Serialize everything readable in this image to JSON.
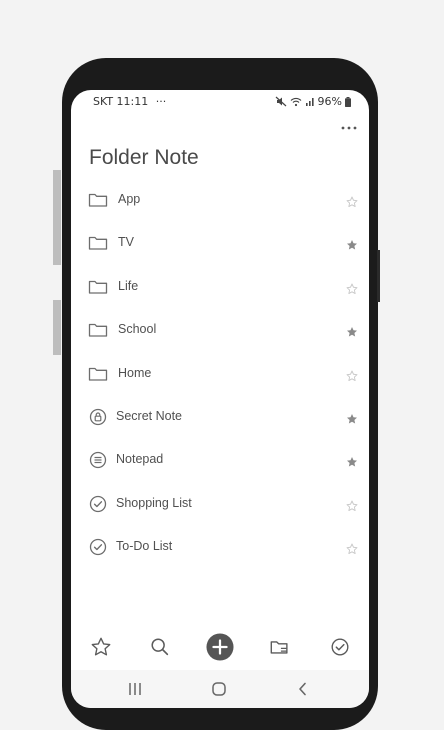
{
  "status_bar": {
    "carrier_time": "SKT 11:11",
    "dots": "···",
    "battery": "96%"
  },
  "page": {
    "title": "Folder Note"
  },
  "items": [
    {
      "label": "App",
      "icon": "folder-icon",
      "starred": false
    },
    {
      "label": "TV",
      "icon": "folder-icon",
      "starred": true
    },
    {
      "label": "Life",
      "icon": "folder-icon",
      "starred": false
    },
    {
      "label": "School",
      "icon": "folder-icon",
      "starred": true
    },
    {
      "label": "Home",
      "icon": "folder-icon",
      "starred": false
    },
    {
      "label": "Secret Note",
      "icon": "lock-icon",
      "starred": true
    },
    {
      "label": "Notepad",
      "icon": "notepad-icon",
      "starred": true
    },
    {
      "label": "Shopping List",
      "icon": "checklist-icon",
      "starred": false
    },
    {
      "label": "To-Do List",
      "icon": "checklist-icon",
      "starred": false
    }
  ],
  "bottom_nav": [
    "star-icon",
    "search-icon",
    "add-icon",
    "folder-list-icon",
    "check-icon"
  ],
  "system_nav": [
    "recents-icon",
    "home-icon",
    "back-icon"
  ],
  "colors": {
    "icon": "#6d6d6d",
    "star_on": "#8a8a8a",
    "star_off": "#c8c8c8",
    "fab": "#555555"
  }
}
